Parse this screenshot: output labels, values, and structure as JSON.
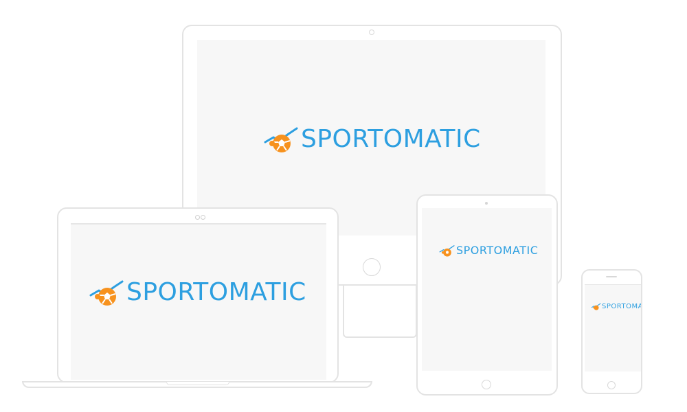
{
  "brand": {
    "name": "SPORTOMATIC",
    "colors": {
      "text": "#2d9fe0",
      "ball_orange": "#f7921e",
      "ball_dark": "#e27410",
      "trend_line": "#2d9fe0"
    },
    "icon": "soccer-ball-trend-icon"
  },
  "devices": [
    {
      "type": "monitor",
      "logo_text": "SPORTOMATIC"
    },
    {
      "type": "laptop",
      "logo_text": "SPORTOMATIC"
    },
    {
      "type": "tablet",
      "logo_text": "SPORTOMATIC"
    },
    {
      "type": "phone",
      "logo_text": "SPORTOMATIC"
    }
  ]
}
